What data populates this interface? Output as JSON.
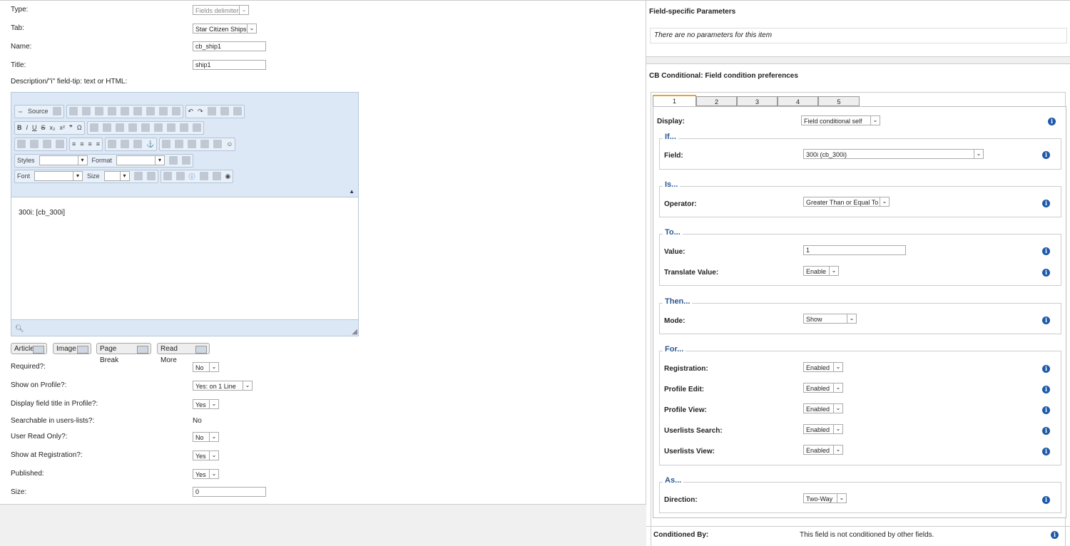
{
  "left": {
    "type_label": "Type:",
    "type_value": "Fields delimiter",
    "tab_label": "Tab:",
    "tab_value": "Star Citizen Ships",
    "name_label": "Name:",
    "name_value": "cb_ship1",
    "title_label": "Title:",
    "title_value": "ship1",
    "desc_label": "Description/\"i\" field-tip: text or HTML:",
    "editor": {
      "source_label": "Source",
      "styles_label": "Styles",
      "format_label": "Format",
      "font_label": "Font",
      "size_label": "Size",
      "content": "300i: [cb_300i]"
    },
    "buttons": [
      "Article",
      "Image",
      "Page Break",
      "Read More"
    ],
    "fields": [
      {
        "label": "Required?:",
        "value": "No"
      },
      {
        "label": "Show on Profile?:",
        "value": "Yes: on 1 Line"
      },
      {
        "label": "Display field title in Profile?:",
        "value": "Yes"
      },
      {
        "label": "Searchable in users-lists?:",
        "value": "No"
      },
      {
        "label": "User Read Only?:",
        "value": "No"
      },
      {
        "label": "Show at Registration?:",
        "value": "Yes"
      },
      {
        "label": "Published:",
        "value": "Yes"
      },
      {
        "label": "Size:",
        "value": "0"
      }
    ]
  },
  "right": {
    "params_title": "Field-specific Parameters",
    "params_empty": "There are no parameters for this item",
    "cond_title": "CB Conditional: Field condition preferences",
    "tabs": [
      "1",
      "2",
      "3",
      "4",
      "5"
    ],
    "display_label": "Display:",
    "display_value": "Field conditional self",
    "if_legend": "If...",
    "field_label": "Field:",
    "field_value": "300i (cb_300i)",
    "is_legend": "Is...",
    "operator_label": "Operator:",
    "operator_value": "Greater Than or Equal To",
    "to_legend": "To...",
    "value_label": "Value:",
    "value_value": "1",
    "translate_label": "Translate Value:",
    "translate_value": "Enable",
    "then_legend": "Then...",
    "mode_label": "Mode:",
    "mode_value": "Show",
    "for_legend": "For...",
    "for_items": [
      {
        "label": "Registration:",
        "value": "Enabled"
      },
      {
        "label": "Profile Edit:",
        "value": "Enabled"
      },
      {
        "label": "Profile View:",
        "value": "Enabled"
      },
      {
        "label": "Userlists Search:",
        "value": "Enabled"
      },
      {
        "label": "Userlists View:",
        "value": "Enabled"
      }
    ],
    "as_legend": "As...",
    "direction_label": "Direction:",
    "direction_value": "Two-Way",
    "conditioned_label": "Conditioned By:",
    "conditioned_value": "This field is not conditioned by other fields."
  }
}
